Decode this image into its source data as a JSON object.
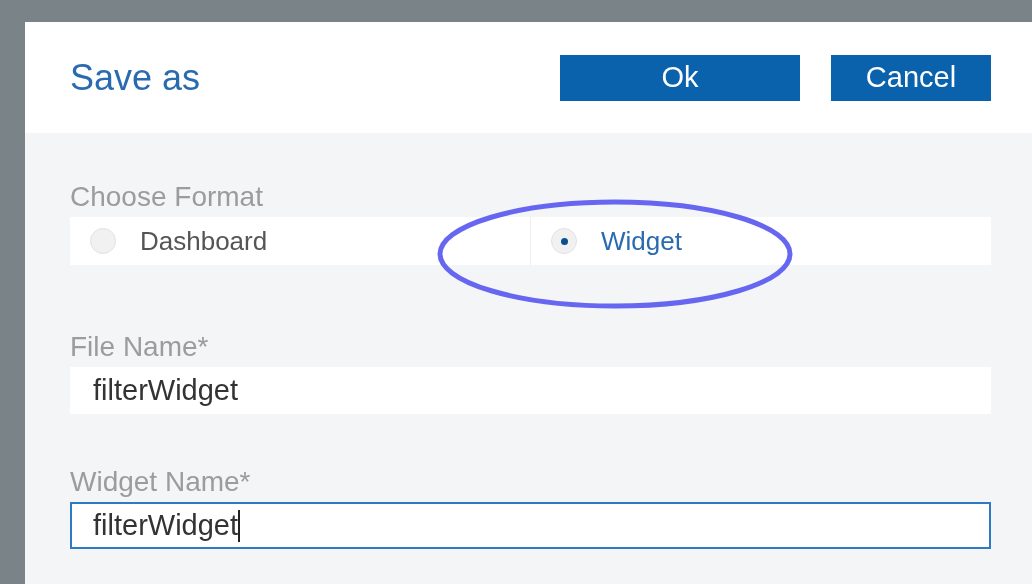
{
  "dialog": {
    "title": "Save as",
    "buttons": [
      "Ok",
      "Cancel"
    ]
  },
  "format": {
    "label": "Choose Format",
    "options": [
      {
        "label": "Dashboard",
        "selected": false
      },
      {
        "label": "Widget",
        "selected": true
      }
    ]
  },
  "fields": [
    {
      "label": "File Name*",
      "value": "filterWidget",
      "focused": false
    },
    {
      "label": "Widget Name*",
      "value": "filterWidget",
      "focused": true
    }
  ]
}
